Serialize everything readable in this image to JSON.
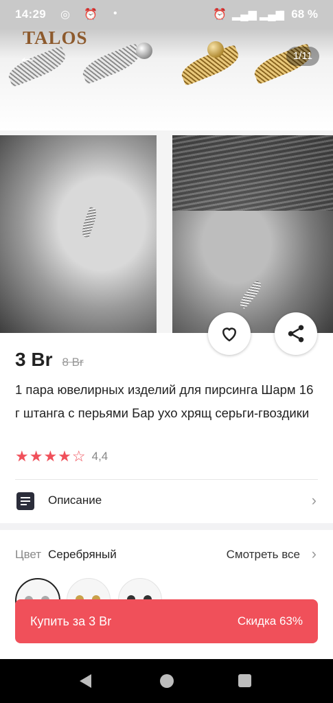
{
  "status_bar": {
    "time": "14:29",
    "battery": "68 %"
  },
  "gallery": {
    "brand": "TALOS",
    "counter": "1/11"
  },
  "product": {
    "price": "3 Br",
    "old_price": "8 Br",
    "title": "1 пара ювелирных изделий для пирсинга Шарм 16 г штанга с перьями Бар ухо хрящ серьги-гвоздики",
    "rating": "4,4",
    "rating_value": 4.4
  },
  "description": {
    "label": "Описание"
  },
  "color": {
    "label": "Цвет",
    "value": "Серебряный",
    "see_all": "Смотреть все"
  },
  "buy": {
    "label": "Купить за 3 Br",
    "discount": "Скидка 63%"
  },
  "colors": {
    "accent": "#f0505a",
    "dark": "#2b2d3a"
  }
}
